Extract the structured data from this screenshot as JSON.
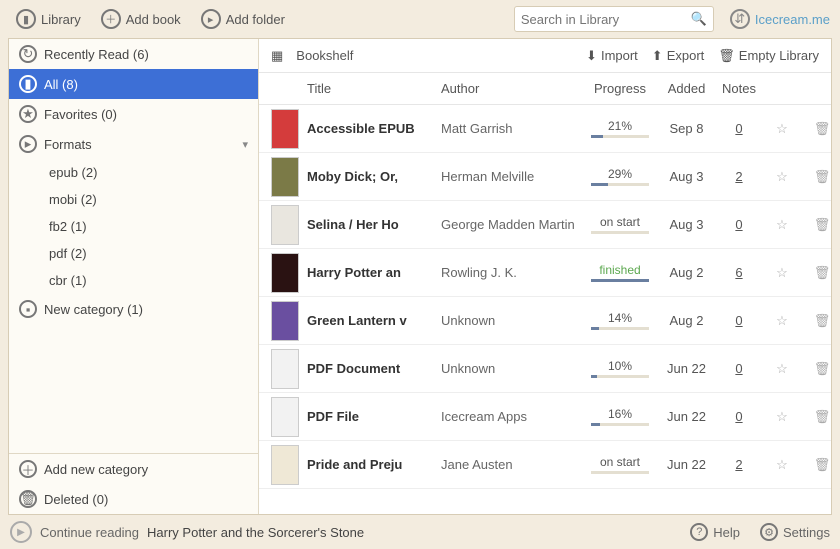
{
  "topbar": {
    "library": "Library",
    "add_book": "Add book",
    "add_folder": "Add folder",
    "search_placeholder": "Search in Library",
    "account": "Icecream.me"
  },
  "sidebar": {
    "recently_read": "Recently Read (6)",
    "all": "All (8)",
    "favorites": "Favorites (0)",
    "formats_label": "Formats",
    "formats": [
      {
        "label": "epub (2)"
      },
      {
        "label": "mobi (2)"
      },
      {
        "label": "fb2 (1)"
      },
      {
        "label": "pdf (2)"
      },
      {
        "label": "cbr (1)"
      }
    ],
    "new_category": "New category (1)",
    "add_new_category": "Add new category",
    "deleted": "Deleted (0)"
  },
  "shelf": {
    "title": "Bookshelf",
    "import": "Import",
    "export": "Export",
    "empty": "Empty Library",
    "columns": {
      "title": "Title",
      "author": "Author",
      "progress": "Progress",
      "added": "Added",
      "notes": "Notes"
    }
  },
  "books": [
    {
      "title": "Accessible EPUB",
      "author": "Matt Garrish",
      "progress": "21%",
      "pct": 21,
      "added": "Sep 8",
      "notes": "0",
      "cover": "#d43c3c"
    },
    {
      "title": "Moby Dick; Or,",
      "author": "Herman Melville",
      "progress": "29%",
      "pct": 29,
      "added": "Aug 3",
      "notes": "2",
      "cover": "#7b7a47"
    },
    {
      "title": "Selina / Her Ho",
      "author": "George Madden Martin",
      "progress": "on start",
      "pct": 0,
      "added": "Aug 3",
      "notes": "0",
      "cover": "#e9e6df"
    },
    {
      "title": "Harry Potter an",
      "author": "Rowling J. K.",
      "progress": "finished",
      "pct": 100,
      "added": "Aug 2",
      "notes": "6",
      "cover": "#2a1212"
    },
    {
      "title": "Green Lantern v",
      "author": "Unknown",
      "progress": "14%",
      "pct": 14,
      "added": "Aug 2",
      "notes": "0",
      "cover": "#6a4fa0"
    },
    {
      "title": "PDF Document",
      "author": "Unknown",
      "progress": "10%",
      "pct": 10,
      "added": "Jun 22",
      "notes": "0",
      "cover": "#f2f2f2"
    },
    {
      "title": "PDF File",
      "author": "Icecream Apps",
      "progress": "16%",
      "pct": 16,
      "added": "Jun 22",
      "notes": "0",
      "cover": "#f2f2f2"
    },
    {
      "title": "Pride and Preju",
      "author": "Jane Austen",
      "progress": "on start",
      "pct": 0,
      "added": "Jun 22",
      "notes": "2",
      "cover": "#efe8d6"
    }
  ],
  "footer": {
    "continue": "Continue reading",
    "book": "Harry Potter and the Sorcerer's Stone",
    "help": "Help",
    "settings": "Settings"
  }
}
